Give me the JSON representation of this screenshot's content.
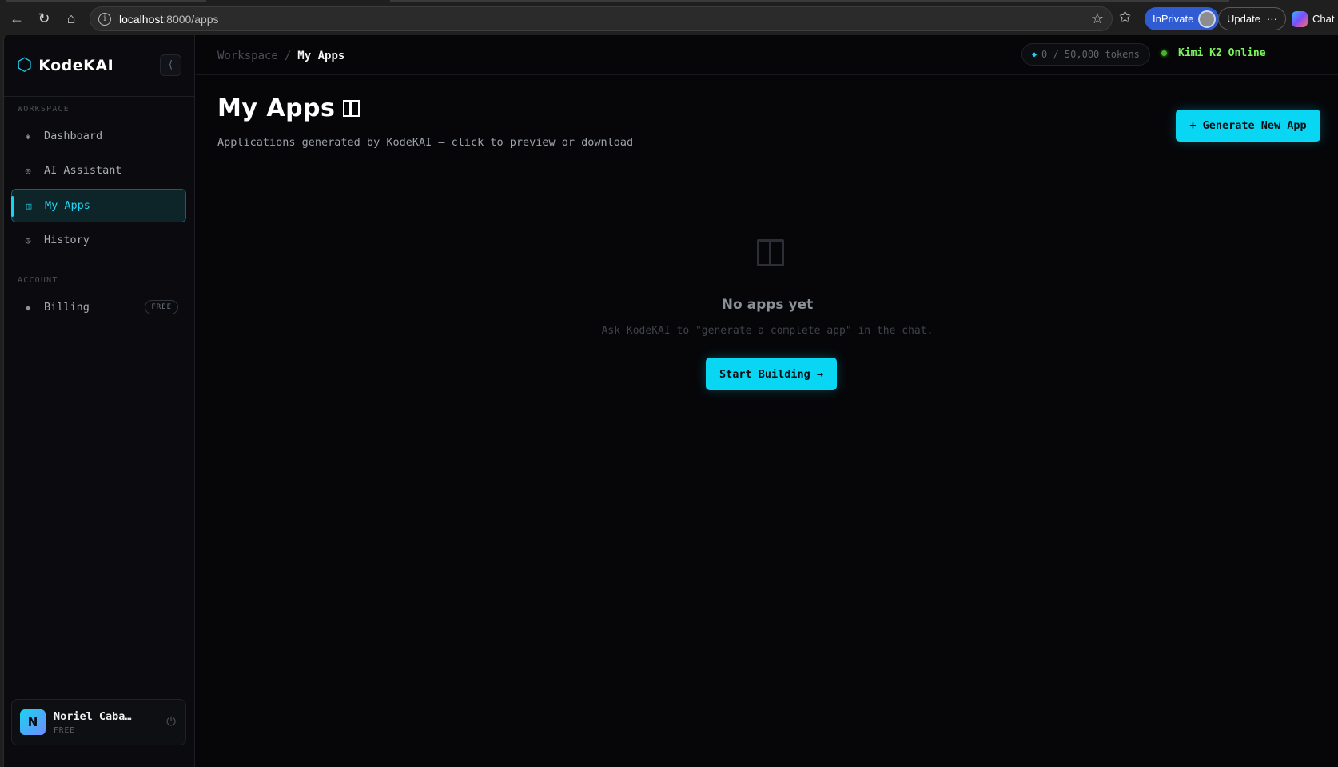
{
  "browser": {
    "url_host": "localhost",
    "url_path": ":8000/apps",
    "inprivate_label": "InPrivate",
    "update_label": "Update",
    "update_more": "···",
    "chat_label": "Chat",
    "back_icon": "←",
    "reload_icon": "↻",
    "home_icon": "⌂",
    "star_icon": "☆",
    "favorites_icon": "✩"
  },
  "sidebar": {
    "brand": "KodeKAI",
    "brand_icon": "⬡",
    "collapse_icon": "⟨",
    "workspace_label": "WORKSPACE",
    "account_label": "ACCOUNT",
    "items": [
      {
        "label": "Dashboard",
        "icon": "◈"
      },
      {
        "label": "AI Assistant",
        "icon": "◎"
      },
      {
        "label": "My Apps",
        "icon": "◫"
      },
      {
        "label": "History",
        "icon": "◷"
      }
    ],
    "billing": {
      "label": "Billing",
      "icon": "◆",
      "badge": "FREE"
    },
    "user": {
      "initial": "N",
      "name": "Noriel Caba…",
      "plan": "FREE",
      "power_icon": "⏻"
    }
  },
  "topbar": {
    "breadcrumb_parent": "Workspace",
    "breadcrumb_sep": "/",
    "breadcrumb_current": "My Apps",
    "tokens_icon": "◆",
    "tokens_text": "0 / 50,000 tokens",
    "status_text": "Kimi K2 Online"
  },
  "page": {
    "title": "My Apps",
    "subtitle": "Applications generated by KodeKAI — click to preview or download",
    "generate_button": "+ Generate New App"
  },
  "empty_state": {
    "title": "No apps yet",
    "hint": "Ask KodeKAI to \"generate a complete app\" in the chat.",
    "button": "Start Building →"
  },
  "colors": {
    "accent": "#09d6f2",
    "online": "#7cf35b",
    "background": "#060609"
  }
}
